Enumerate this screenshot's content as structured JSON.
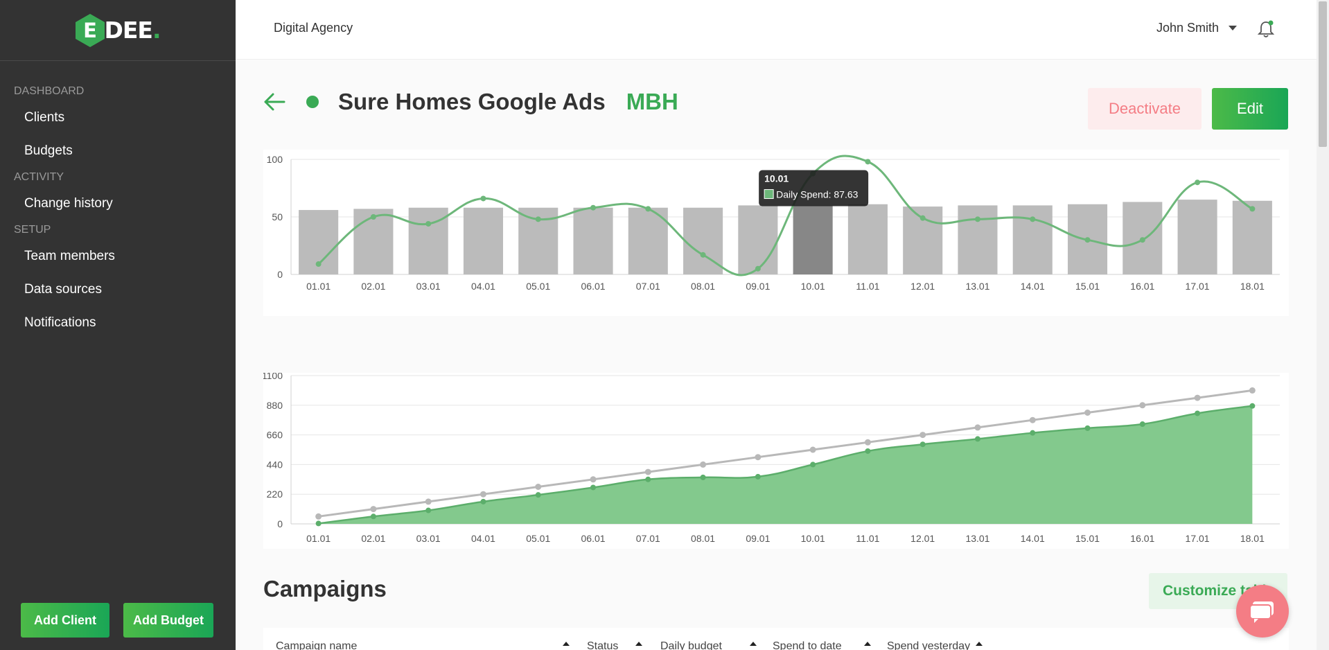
{
  "brand": {
    "logo_letter": "E",
    "logo_text": "DEE",
    "logo_dot": ".",
    "accent_color": "#3aaa55"
  },
  "sidebar": {
    "sections": [
      {
        "label": "DASHBOARD",
        "items": [
          {
            "label": "Clients"
          },
          {
            "label": "Budgets"
          }
        ]
      },
      {
        "label": "ACTIVITY",
        "items": [
          {
            "label": "Change history"
          }
        ]
      },
      {
        "label": "SETUP",
        "items": [
          {
            "label": "Team members"
          },
          {
            "label": "Data sources"
          },
          {
            "label": "Notifications"
          }
        ]
      }
    ],
    "add_client_label": "Add Client",
    "add_budget_label": "Add Budget"
  },
  "topbar": {
    "agency_name": "Digital Agency",
    "user_name": "John Smith"
  },
  "page": {
    "campaign_title": "Sure Homes Google Ads",
    "client_code": "MBH",
    "deactivate_label": "Deactivate",
    "edit_label": "Edit",
    "campaigns_title": "Campaigns",
    "customize_label": "Customize table"
  },
  "table": {
    "columns": [
      "Campaign name",
      "Status",
      "Daily budget",
      "Spend to date",
      "Spend yesterday"
    ]
  },
  "chart_data": [
    {
      "type": "bar",
      "categories": [
        "01.01",
        "02.01",
        "03.01",
        "04.01",
        "05.01",
        "06.01",
        "07.01",
        "08.01",
        "09.01",
        "10.01",
        "11.01",
        "12.01",
        "13.01",
        "14.01",
        "15.01",
        "16.01",
        "17.01",
        "18.01"
      ],
      "series": [
        {
          "type": "bar",
          "values": [
            56,
            57,
            58,
            58,
            58,
            58,
            58,
            58,
            60,
            60,
            61,
            59,
            60,
            60,
            61,
            63,
            65,
            64
          ]
        },
        {
          "type": "line",
          "name": "Daily Spend",
          "values": [
            9,
            50,
            44,
            66,
            48,
            58,
            57,
            17,
            5,
            87.63,
            98,
            49,
            48,
            48,
            30,
            30,
            80,
            57
          ]
        }
      ],
      "yticks": [
        0,
        50,
        100
      ],
      "ylim": [
        0,
        100
      ],
      "highlight_index": 9,
      "tooltip": {
        "title": "10.01",
        "label": "Daily Spend: 87.63"
      },
      "bar_color": "#bbbbbb",
      "bar_highlight_color": "#878787",
      "line_color": "#6db77a"
    },
    {
      "type": "area",
      "categories": [
        "01.01",
        "02.01",
        "03.01",
        "04.01",
        "05.01",
        "06.01",
        "07.01",
        "08.01",
        "09.01",
        "10.01",
        "11.01",
        "12.01",
        "13.01",
        "14.01",
        "15.01",
        "16.01",
        "17.01",
        "18.01"
      ],
      "series": [
        {
          "type": "line",
          "values": [
            55,
            110,
            165,
            220,
            275,
            330,
            385,
            440,
            495,
            550,
            605,
            660,
            715,
            770,
            825,
            880,
            935,
            990
          ]
        },
        {
          "type": "area",
          "values": [
            3,
            55,
            100,
            165,
            215,
            270,
            330,
            345,
            350,
            440,
            540,
            590,
            630,
            675,
            710,
            740,
            820,
            875
          ]
        }
      ],
      "yticks": [
        0,
        220,
        440,
        660,
        880,
        1100
      ],
      "ylim": [
        0,
        1100
      ],
      "line_color": "#b8b8b8",
      "area_color": "#83c98d",
      "area_line_color": "#5cae6b"
    }
  ]
}
